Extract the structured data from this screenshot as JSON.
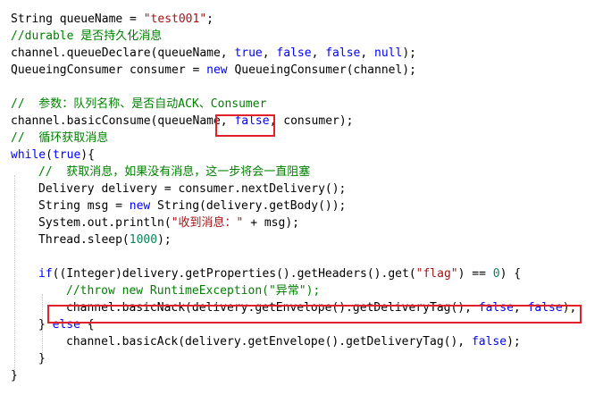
{
  "code": {
    "lines": [
      {
        "indent": 0,
        "tokens": [
          {
            "t": "plain",
            "v": "String queueName = "
          },
          {
            "t": "str",
            "v": "\"test001\""
          },
          {
            "t": "plain",
            "v": ";"
          }
        ]
      },
      {
        "indent": 0,
        "tokens": [
          {
            "t": "com",
            "v": "//durable 是否持久化消息"
          }
        ]
      },
      {
        "indent": 0,
        "tokens": [
          {
            "t": "plain",
            "v": "channel.queueDeclare(queueName, "
          },
          {
            "t": "kw",
            "v": "true"
          },
          {
            "t": "plain",
            "v": ", "
          },
          {
            "t": "kw",
            "v": "false"
          },
          {
            "t": "plain",
            "v": ", "
          },
          {
            "t": "kw",
            "v": "false"
          },
          {
            "t": "plain",
            "v": ", "
          },
          {
            "t": "kw",
            "v": "null"
          },
          {
            "t": "plain",
            "v": ");"
          }
        ]
      },
      {
        "indent": 0,
        "tokens": [
          {
            "t": "plain",
            "v": "QueueingConsumer consumer = "
          },
          {
            "t": "kw",
            "v": "new"
          },
          {
            "t": "plain",
            "v": " QueueingConsumer(channel);"
          }
        ]
      },
      {
        "indent": 0,
        "tokens": []
      },
      {
        "indent": 0,
        "tokens": [
          {
            "t": "com",
            "v": "//  参数：队列名称、是否自动ACK、Consumer"
          }
        ]
      },
      {
        "indent": 0,
        "tokens": [
          {
            "t": "plain",
            "v": "channel.basicConsume(queueName, "
          },
          {
            "t": "kw",
            "v": "false"
          },
          {
            "t": "plain",
            "v": ", consumer);"
          }
        ]
      },
      {
        "indent": 0,
        "tokens": [
          {
            "t": "com",
            "v": "//  循环获取消息"
          }
        ]
      },
      {
        "indent": 0,
        "tokens": [
          {
            "t": "kw",
            "v": "while"
          },
          {
            "t": "plain",
            "v": "("
          },
          {
            "t": "kw",
            "v": "true"
          },
          {
            "t": "plain",
            "v": "){"
          }
        ]
      },
      {
        "indent": 1,
        "tokens": [
          {
            "t": "com",
            "v": "//  获取消息，如果没有消息，这一步将会一直阻塞"
          }
        ]
      },
      {
        "indent": 1,
        "tokens": [
          {
            "t": "plain",
            "v": "Delivery delivery = consumer.nextDelivery();"
          }
        ]
      },
      {
        "indent": 1,
        "tokens": [
          {
            "t": "plain",
            "v": "String msg = "
          },
          {
            "t": "kw",
            "v": "new"
          },
          {
            "t": "plain",
            "v": " String(delivery.getBody());"
          }
        ]
      },
      {
        "indent": 1,
        "tokens": [
          {
            "t": "plain",
            "v": "System.out.println("
          },
          {
            "t": "str",
            "v": "\"收到消息：\""
          },
          {
            "t": "plain",
            "v": " + msg);"
          }
        ]
      },
      {
        "indent": 1,
        "tokens": [
          {
            "t": "plain",
            "v": "Thread.sleep("
          },
          {
            "t": "num",
            "v": "1000"
          },
          {
            "t": "plain",
            "v": ");"
          }
        ]
      },
      {
        "indent": 1,
        "tokens": []
      },
      {
        "indent": 1,
        "tokens": [
          {
            "t": "kw",
            "v": "if"
          },
          {
            "t": "plain",
            "v": "((Integer)delivery.getProperties().getHeaders().get("
          },
          {
            "t": "str",
            "v": "\"flag\""
          },
          {
            "t": "plain",
            "v": ") == "
          },
          {
            "t": "num",
            "v": "0"
          },
          {
            "t": "plain",
            "v": ") {"
          }
        ]
      },
      {
        "indent": 2,
        "tokens": [
          {
            "t": "com",
            "v": "//throw new RuntimeException(\"异常\");"
          }
        ]
      },
      {
        "indent": 2,
        "tokens": [
          {
            "t": "plain",
            "v": "channel.basicNack(delivery.getEnvelope().getDeliveryTag(), "
          },
          {
            "t": "kw",
            "v": "false"
          },
          {
            "t": "plain",
            "v": ", "
          },
          {
            "t": "kw",
            "v": "false"
          },
          {
            "t": "plain",
            "v": ");"
          }
        ]
      },
      {
        "indent": 1,
        "tokens": [
          {
            "t": "plain",
            "v": "} "
          },
          {
            "t": "kw",
            "v": "else"
          },
          {
            "t": "plain",
            "v": " {"
          }
        ]
      },
      {
        "indent": 2,
        "tokens": [
          {
            "t": "plain",
            "v": "channel.basicAck(delivery.getEnvelope().getDeliveryTag(), "
          },
          {
            "t": "kw",
            "v": "false"
          },
          {
            "t": "plain",
            "v": ");"
          }
        ]
      },
      {
        "indent": 1,
        "tokens": [
          {
            "t": "plain",
            "v": "}"
          }
        ]
      },
      {
        "indent": 0,
        "tokens": [
          {
            "t": "plain",
            "v": "}"
          }
        ]
      }
    ]
  },
  "highlight_color": "#e0202a",
  "syntax_colors": {
    "keyword": "#0000ff",
    "string": "#a31515",
    "comment": "#008000",
    "number": "#098658"
  }
}
